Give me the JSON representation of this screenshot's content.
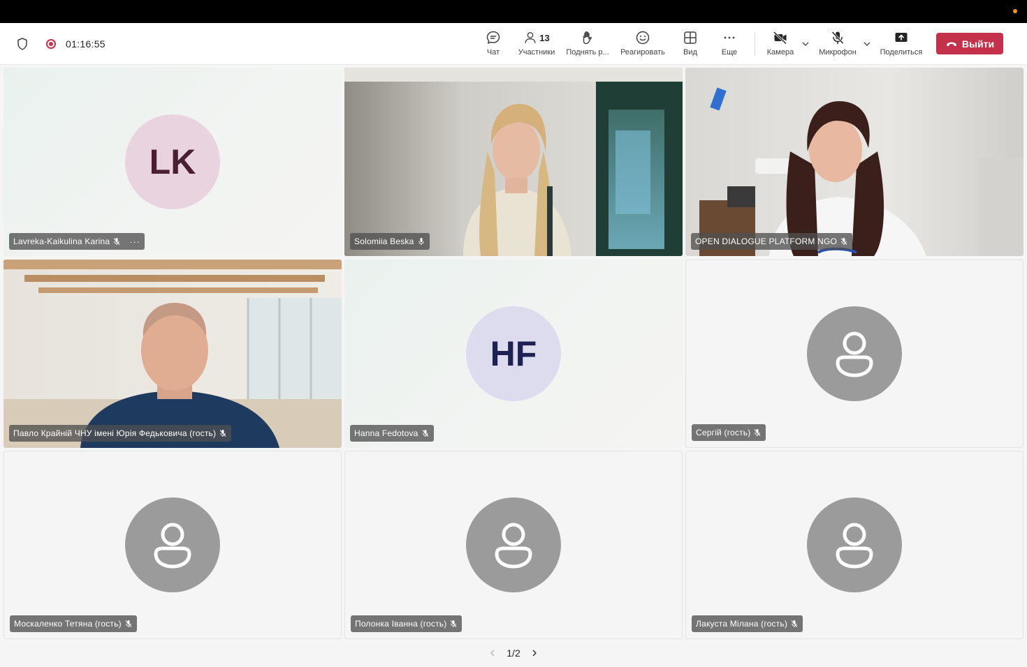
{
  "meeting": {
    "timer": "01:16:55"
  },
  "toolbar": {
    "chat_label": "Чат",
    "participants_count": "13",
    "participants_label": "Участники",
    "raise_label": "Поднять р...",
    "react_label": "Реагировать",
    "view_label": "Вид",
    "more_label": "Еще",
    "camera_label": "Камера",
    "mic_label": "Микрофон",
    "share_label": "Поделиться",
    "leave_label": "Выйти"
  },
  "tiles": [
    {
      "name": "Lavreka-Kaikulina Karina",
      "initials": "LK"
    },
    {
      "name": "Solomiia Beska"
    },
    {
      "name": "OPEN DIALOGUE PLATFORM NGO"
    },
    {
      "name": "Павло Крайній ЧНУ імені Юрія Федьковича (гость)"
    },
    {
      "name": "Hanna Fedotova",
      "initials": "HF"
    },
    {
      "name": "Сергій (гость)"
    },
    {
      "name": "Москаленко Тетяна (гость)"
    },
    {
      "name": "Полонка Іванна (гость)"
    },
    {
      "name": "Лакуста Мілана (гость)"
    }
  ],
  "pager": {
    "label": "1/2"
  },
  "colors": {
    "accent": "#6264a7",
    "leave": "#c4314b",
    "record": "#c4314b"
  }
}
